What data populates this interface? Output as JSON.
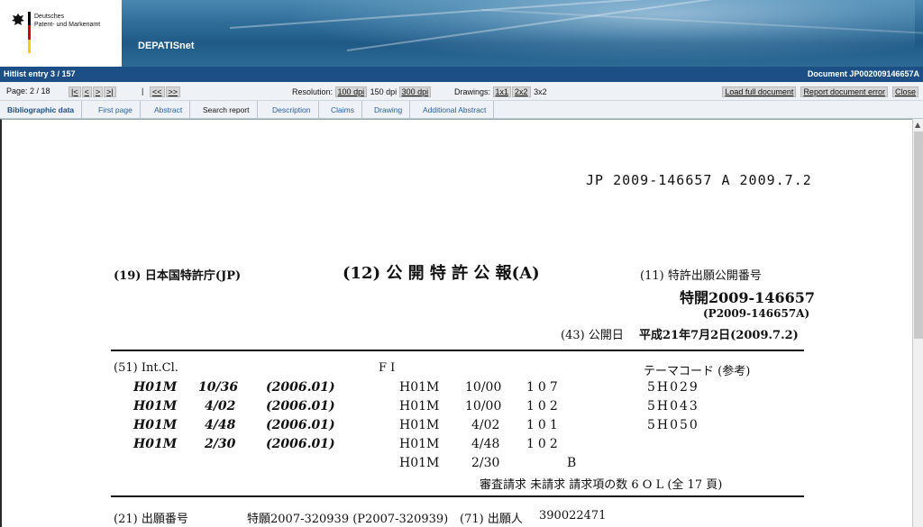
{
  "header": {
    "org_line1": "Deutsches",
    "org_line2": "Patent- und Markenamt",
    "brand": "DEPATISnet"
  },
  "hitlist": {
    "entry": "Hitlist entry 3 / 157",
    "document": "Document JP002009146657A"
  },
  "toolbar": {
    "page": "Page: 2 / 18",
    "nav": [
      "|<",
      "<",
      ">",
      ">|"
    ],
    "sep": "|",
    "nav2": [
      "<<",
      ">>"
    ],
    "resolution_label": "Resolution:",
    "res_100": "100 dpi",
    "res_150": "150 dpi",
    "res_300": "300 dpi",
    "drawings_label": "Drawings:",
    "draw_1": "1x1",
    "draw_2": "2x2",
    "draw_3": "3x2",
    "load_full": "Load full document",
    "report_error": "Report document error",
    "close": "Close"
  },
  "tabs": [
    "Bibliographic data",
    "First page",
    "Abstract",
    "Search report",
    "Description",
    "Claims",
    "Drawing",
    "Additional Abstract"
  ],
  "document": {
    "header_ref": "JP 2009-146657 A 2009.7.2",
    "office": "(19) 日本国特許庁(JP)",
    "kind": "(12) 公 開 特 許 公 報(A)",
    "pub_label": "(11) 特許出願公開番号",
    "pub_number": "特開2009-146657",
    "pub_number_alt": "(P2009-146657A)",
    "pub_date_label": "(43) 公開日",
    "pub_date": "平成21年7月2日(2009.7.2)",
    "intcl_label": "(51) Int.Cl.",
    "intcl": [
      {
        "code": "H01M",
        "group": "10/36",
        "ver": "(2006.01)"
      },
      {
        "code": "H01M",
        "group": "4/02",
        "ver": "(2006.01)"
      },
      {
        "code": "H01M",
        "group": "4/48",
        "ver": "(2006.01)"
      },
      {
        "code": "H01M",
        "group": "2/30",
        "ver": "(2006.01)"
      }
    ],
    "fi_label": "F I",
    "fi": [
      {
        "code": "H01M",
        "group": "10/00",
        "num": "107"
      },
      {
        "code": "H01M",
        "group": "10/00",
        "num": "102"
      },
      {
        "code": "H01M",
        "group": "4/02",
        "num": "101"
      },
      {
        "code": "H01M",
        "group": "4/48",
        "num": "102"
      },
      {
        "code": "H01M",
        "group": "2/30",
        "num": "B"
      }
    ],
    "theme_label": "テーマコード (参考)",
    "themes": [
      "5H029",
      "5H043",
      "5H050"
    ],
    "exam_line": "審査請求 未請求  請求項の数 6  O L  (全 17 頁)",
    "appl_label": "(21) 出願番号",
    "appl_number": "特願2007-320939 (P2007-320939)",
    "applicant_label": "(71) 出願人",
    "applicant": "390022471"
  }
}
